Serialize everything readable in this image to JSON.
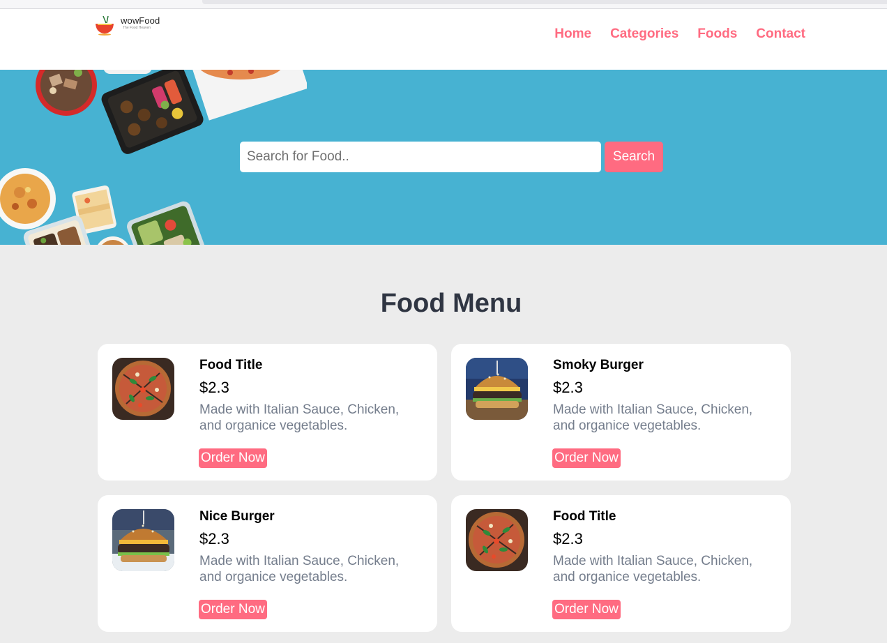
{
  "brand": {
    "name": "wowFood",
    "tagline": "The Food Heaven"
  },
  "nav": {
    "items": [
      {
        "label": "Home"
      },
      {
        "label": "Categories"
      },
      {
        "label": "Foods"
      },
      {
        "label": "Contact"
      }
    ]
  },
  "search": {
    "placeholder": "Search for Food..",
    "value": "",
    "button_label": "Search"
  },
  "menu": {
    "title": "Food Menu",
    "items": [
      {
        "title": "Food Title",
        "price": "$2.3",
        "description": "Made with Italian Sauce, Chicken, and organice vegetables.",
        "button": "Order Now",
        "image": "pizza"
      },
      {
        "title": "Smoky Burger",
        "price": "$2.3",
        "description": "Made with Italian Sauce, Chicken, and organice vegetables.",
        "button": "Order Now",
        "image": "burger"
      },
      {
        "title": "Nice Burger",
        "price": "$2.3",
        "description": "Made with Italian Sauce, Chicken, and organice vegetables.",
        "button": "Order Now",
        "image": "burger"
      },
      {
        "title": "Food Title",
        "price": "$2.3",
        "description": "Made with Italian Sauce, Chicken, and organice vegetables.",
        "button": "Order Now",
        "image": "pizza"
      }
    ]
  },
  "colors": {
    "accent": "#ff6b81",
    "hero": "#47b2d2",
    "page_bg": "#ececec",
    "heading": "#2f3542",
    "muted": "#747d8c"
  }
}
